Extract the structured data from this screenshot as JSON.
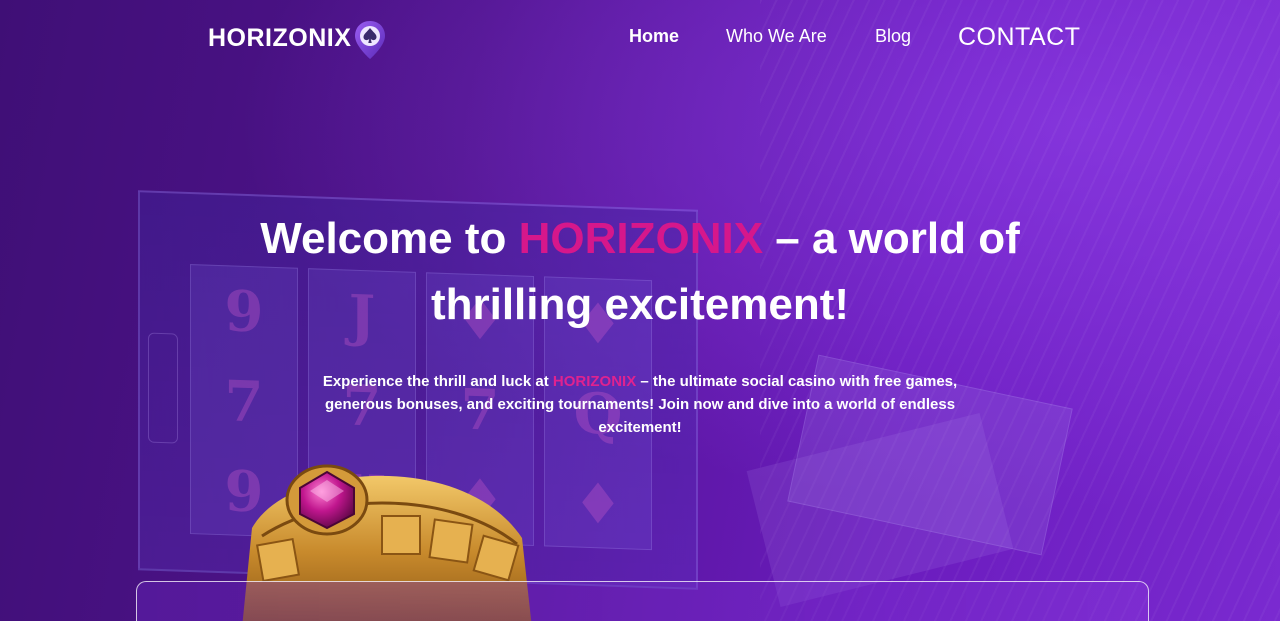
{
  "brand": {
    "name": "HORIZONIX",
    "logo_icon": "spade-pin-icon",
    "accent_color": "#d6178b"
  },
  "nav": {
    "items": [
      {
        "label": "Home",
        "active": true
      },
      {
        "label": "Who We Are",
        "active": false
      },
      {
        "label": "Blog",
        "active": false
      },
      {
        "label": "CONTACT",
        "active": false
      }
    ]
  },
  "hero": {
    "title_prefix": "Welcome to ",
    "title_brand": "HORIZONIX",
    "title_suffix": " – a world of thrilling excitement!",
    "subtitle_prefix": "Experience the thrill and luck at ",
    "subtitle_brand": "HORIZONIX",
    "subtitle_suffix": " – the ultimate social casino with free games, generous bonuses, and exciting tournaments! Join now and dive into a world of endless excitement!"
  },
  "colors": {
    "background": "#4a1285",
    "highlight": "#d6178b"
  }
}
